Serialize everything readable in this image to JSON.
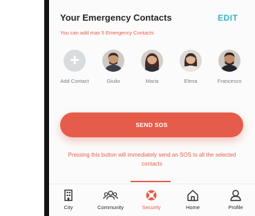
{
  "header": {
    "title": "Your Emergency Contacts",
    "edit_label": "EDIT",
    "subtitle": "You can add max 5 Emergency Contacts"
  },
  "contacts": {
    "add_label": "Add Contact",
    "items": [
      {
        "name": "Giulio"
      },
      {
        "name": "Maria"
      },
      {
        "name": "Elena"
      },
      {
        "name": "Francesco"
      }
    ]
  },
  "sos": {
    "button_label": "SEND SOS",
    "warning": "Pressing this button will immediately send an SOS to all the selected contacts"
  },
  "tabs": [
    {
      "label": "City",
      "icon": "building-icon"
    },
    {
      "label": "Community",
      "icon": "people-icon"
    },
    {
      "label": "Security",
      "icon": "lifebuoy-icon",
      "active": true
    },
    {
      "label": "Home",
      "icon": "home-icon"
    },
    {
      "label": "Profile",
      "icon": "user-icon"
    }
  ],
  "colors": {
    "accent": "#e55d4a",
    "edit": "#3ab4c8"
  }
}
